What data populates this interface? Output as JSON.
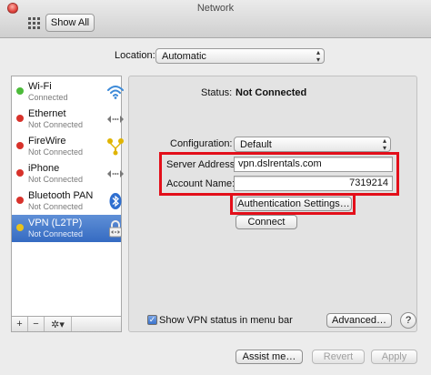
{
  "window": {
    "title": "Network"
  },
  "toolbar": {
    "show_all_label": "Show All"
  },
  "location": {
    "label": "Location:",
    "value": "Automatic"
  },
  "services": [
    {
      "name": "Wi-Fi",
      "status": "Connected",
      "dot_color": "#4cbb3a",
      "icon": "wifi-icon"
    },
    {
      "name": "Ethernet",
      "status": "Not Connected",
      "dot_color": "#d8322b",
      "icon": "ethernet-icon"
    },
    {
      "name": "FireWire",
      "status": "Not Connected",
      "dot_color": "#d8322b",
      "icon": "firewire-icon"
    },
    {
      "name": "iPhone",
      "status": "Not Connected",
      "dot_color": "#d8322b",
      "icon": "iphone-icon"
    },
    {
      "name": "Bluetooth PAN",
      "status": "Not Connected",
      "dot_color": "#d8322b",
      "icon": "bluetooth-icon"
    },
    {
      "name": "VPN (L2TP)",
      "status": "Not Connected",
      "dot_color": "#e8c21c",
      "icon": "vpn-lock-icon"
    }
  ],
  "sidebar_toolbar": {
    "add": "+",
    "remove": "−",
    "gear": "✲▾"
  },
  "detail": {
    "status_label": "Status:",
    "status_value": "Not Connected",
    "configuration_label": "Configuration:",
    "configuration_value": "Default",
    "server_label": "Server Address:",
    "server_value": "vpn.dslrentals.com",
    "account_label": "Account Name:",
    "account_value": "7319214",
    "auth_button": "Authentication Settings…",
    "connect_button": "Connect",
    "show_status_label": "Show VPN status in menu bar",
    "advanced_button": "Advanced…",
    "help": "?"
  },
  "footer": {
    "assist": "Assist me…",
    "revert": "Revert",
    "apply": "Apply"
  },
  "colors": {
    "highlight": "#e30f1a",
    "selection": "#356bc2"
  }
}
